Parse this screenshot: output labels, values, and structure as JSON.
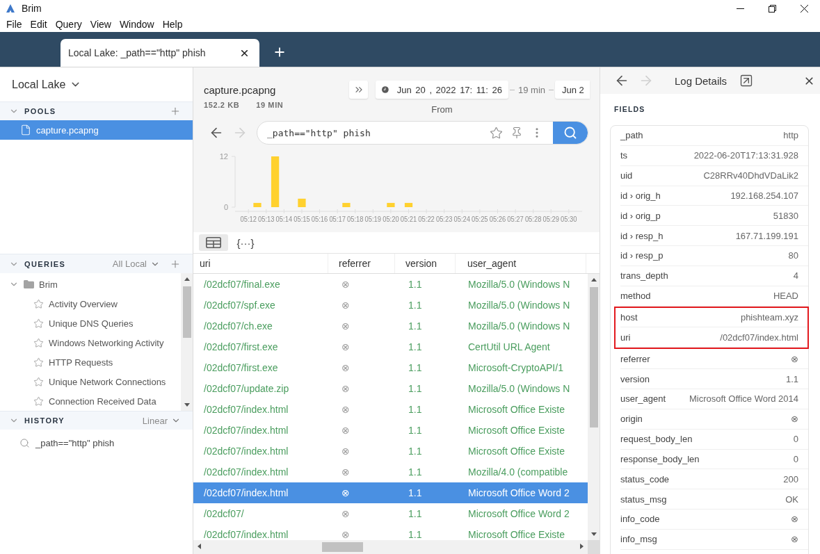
{
  "window": {
    "title": "Brim"
  },
  "menu": [
    "File",
    "Edit",
    "Query",
    "View",
    "Window",
    "Help"
  ],
  "tabs": [
    {
      "label": "Local Lake: _path==\"http\" phish",
      "selected": true
    }
  ],
  "sidebar": {
    "lake": "Local Lake",
    "pools": {
      "title": "POOLS",
      "expanded": true,
      "items": [
        {
          "name": "capture.pcapng",
          "selected": true
        }
      ]
    },
    "queries": {
      "title": "QUERIES",
      "expanded": true,
      "filter": "All Local",
      "tree": [
        {
          "name": "Brim",
          "expanded": true,
          "children": [
            {
              "name": "Activity Overview"
            },
            {
              "name": "Unique DNS Queries"
            },
            {
              "name": "Windows Networking Activity"
            },
            {
              "name": "HTTP Requests"
            },
            {
              "name": "Unique Network Connections"
            },
            {
              "name": "Connection Received Data"
            }
          ]
        }
      ]
    },
    "history": {
      "title": "HISTORY",
      "expanded": true,
      "mode": "Linear",
      "items": [
        "_path==\"http\" phish"
      ]
    }
  },
  "pool": {
    "name": "capture.pcapng",
    "size": "152.2 KB",
    "duration": "19 MIN"
  },
  "time_range": {
    "from": "Jun 20 , 2022 17: 11: 26",
    "from_label": "From",
    "span": "19 min",
    "to": "Jun 2"
  },
  "search": {
    "nav": [
      {
        "kind": "back",
        "disabled": false
      },
      {
        "kind": "forward",
        "disabled": true
      }
    ],
    "value": "_path==\"http\" phish"
  },
  "histogram": {
    "chart_data": {
      "type": "bar",
      "categories": [
        null,
        "05:12",
        null,
        "05:13",
        null,
        "05:14",
        null,
        "05:15",
        null,
        "05:16",
        null,
        "05:17",
        null,
        "05:18",
        null,
        "05:19",
        null,
        "05:20",
        null,
        "05:21",
        null,
        "05:22",
        null,
        "05:23",
        null,
        "05:24",
        null,
        "05:25",
        null,
        "05:26",
        null,
        "05:27",
        null,
        "05:28",
        null,
        "05:29",
        null,
        "05:30",
        null
      ],
      "values": [
        0,
        0,
        1,
        0,
        12,
        0,
        0,
        2,
        0,
        0,
        0,
        0,
        1,
        0,
        0,
        0,
        0,
        1,
        0,
        1,
        0,
        0,
        0,
        0,
        0,
        0,
        0,
        0,
        0,
        0,
        0,
        0,
        0,
        0,
        0,
        0,
        0,
        0,
        0
      ],
      "ylim": [
        0,
        12
      ],
      "yticks": [
        0,
        12
      ]
    }
  },
  "view_modes": [
    {
      "kind": "table",
      "selected": true
    },
    {
      "kind": "json",
      "label": "{···}",
      "selected": false
    }
  ],
  "table": {
    "columns": [
      "uri",
      "referrer",
      "version",
      "user_agent"
    ],
    "rows": [
      {
        "cells": [
          "/02dcf07/final.exe",
          "⊗",
          "1.1",
          "Mozilla/5.0 (Windows N"
        ],
        "selected": false
      },
      {
        "cells": [
          "/02dcf07/spf.exe",
          "⊗",
          "1.1",
          "Mozilla/5.0 (Windows N"
        ],
        "selected": false
      },
      {
        "cells": [
          "/02dcf07/ch.exe",
          "⊗",
          "1.1",
          "Mozilla/5.0 (Windows N"
        ],
        "selected": false
      },
      {
        "cells": [
          "/02dcf07/first.exe",
          "⊗",
          "1.1",
          "CertUtil URL Agent"
        ],
        "selected": false
      },
      {
        "cells": [
          "/02dcf07/first.exe",
          "⊗",
          "1.1",
          "Microsoft-CryptoAPI/1"
        ],
        "selected": false
      },
      {
        "cells": [
          "/02dcf07/update.zip",
          "⊗",
          "1.1",
          "Mozilla/5.0 (Windows N"
        ],
        "selected": false
      },
      {
        "cells": [
          "/02dcf07/index.html",
          "⊗",
          "1.1",
          "Microsoft Office Existe"
        ],
        "selected": false
      },
      {
        "cells": [
          "/02dcf07/index.html",
          "⊗",
          "1.1",
          "Microsoft Office Existe"
        ],
        "selected": false
      },
      {
        "cells": [
          "/02dcf07/index.html",
          "⊗",
          "1.1",
          "Microsoft Office Existe"
        ],
        "selected": false
      },
      {
        "cells": [
          "/02dcf07/index.html",
          "⊗",
          "1.1",
          "Mozilla/4.0 (compatible"
        ],
        "selected": false
      },
      {
        "cells": [
          "/02dcf07/index.html",
          "⊗",
          "1.1",
          "Microsoft Office Word 2"
        ],
        "selected": true
      },
      {
        "cells": [
          "/02dcf07/",
          "⊗",
          "1.1",
          "Microsoft Office Word 2"
        ],
        "selected": false
      },
      {
        "cells": [
          "/02dcf07/index.html",
          "⊗",
          "1.1",
          "Microsoft Office Existe"
        ],
        "selected": false
      }
    ]
  },
  "log_details": {
    "nav": [
      {
        "kind": "back",
        "disabled": false
      },
      {
        "kind": "forward",
        "disabled": true
      }
    ],
    "title": "Log Details",
    "section": "FIELDS",
    "fields": [
      {
        "name": "_path",
        "value": "http",
        "highlighted": false
      },
      {
        "name": "ts",
        "value": "2022-06-20T17:13:31.928",
        "highlighted": false
      },
      {
        "name": "uid",
        "value": "C28RRv40DhdVDaLik2",
        "highlighted": false
      },
      {
        "name": "id › orig_h",
        "value": "192.168.254.107",
        "highlighted": false
      },
      {
        "name": "id › orig_p",
        "value": "51830",
        "highlighted": false
      },
      {
        "name": "id › resp_h",
        "value": "167.71.199.191",
        "highlighted": false
      },
      {
        "name": "id › resp_p",
        "value": "80",
        "highlighted": false
      },
      {
        "name": "trans_depth",
        "value": "4",
        "highlighted": false
      },
      {
        "name": "method",
        "value": "HEAD",
        "highlighted": false
      },
      {
        "name": "host",
        "value": "phishteam.xyz",
        "highlighted": true
      },
      {
        "name": "uri",
        "value": "/02dcf07/index.html",
        "highlighted": true
      },
      {
        "name": "referrer",
        "value": "⊗",
        "highlighted": false
      },
      {
        "name": "version",
        "value": "1.1",
        "highlighted": false
      },
      {
        "name": "user_agent",
        "value": "Microsoft Office Word 2014",
        "highlighted": false
      },
      {
        "name": "origin",
        "value": "⊗",
        "highlighted": false
      },
      {
        "name": "request_body_len",
        "value": "0",
        "highlighted": false
      },
      {
        "name": "response_body_len",
        "value": "0",
        "highlighted": false
      },
      {
        "name": "status_code",
        "value": "200",
        "highlighted": false
      },
      {
        "name": "status_msg",
        "value": "OK",
        "highlighted": false
      },
      {
        "name": "info_code",
        "value": "⊗",
        "highlighted": false
      },
      {
        "name": "info_msg",
        "value": "⊗",
        "highlighted": false
      }
    ]
  }
}
